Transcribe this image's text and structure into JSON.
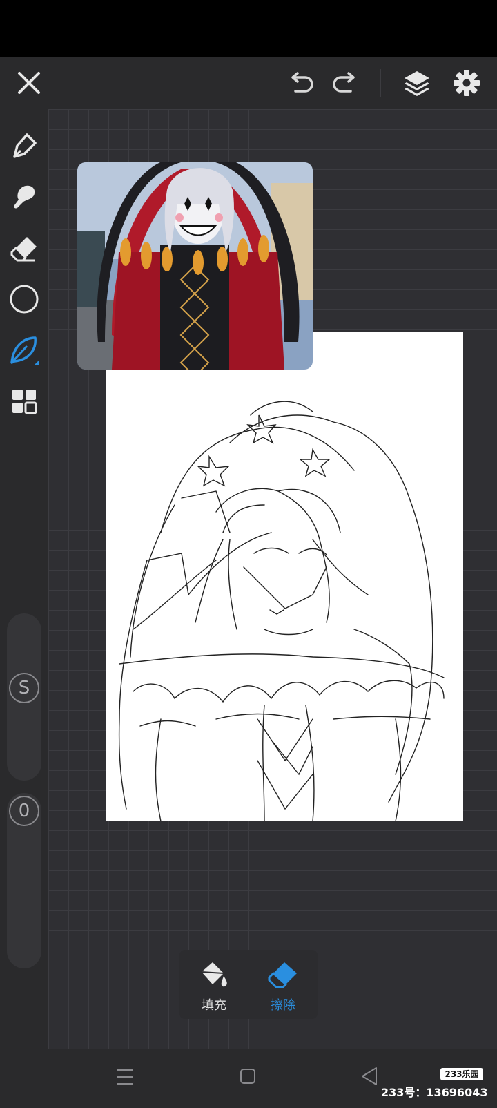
{
  "toolbar": {
    "close_icon": "close-icon",
    "undo_icon": "undo-icon",
    "redo_icon": "redo-icon",
    "layers_icon": "layers-icon",
    "settings_icon": "gear-icon"
  },
  "tools": [
    {
      "name": "pen-tool",
      "icon": "pen-icon"
    },
    {
      "name": "smudge-tool",
      "icon": "smudge-icon"
    },
    {
      "name": "eraser-tool",
      "icon": "eraser-icon"
    },
    {
      "name": "shape-tool",
      "icon": "circle-icon"
    },
    {
      "name": "brush-tool",
      "icon": "leaf-icon",
      "active": true
    },
    {
      "name": "grid-tool",
      "icon": "grid-icon"
    }
  ],
  "sliders": {
    "size_label": "S",
    "opacity_label": "0"
  },
  "fill_popup": {
    "fill_label": "填充",
    "erase_label": "擦除",
    "active": "erase"
  },
  "watermark": {
    "logo": "233乐园",
    "id_text": "233号：13696043"
  },
  "colors": {
    "accent": "#2a8fe0",
    "toolbar_bg": "#2a2a2c",
    "canvas_bg": "#2f2f33"
  }
}
